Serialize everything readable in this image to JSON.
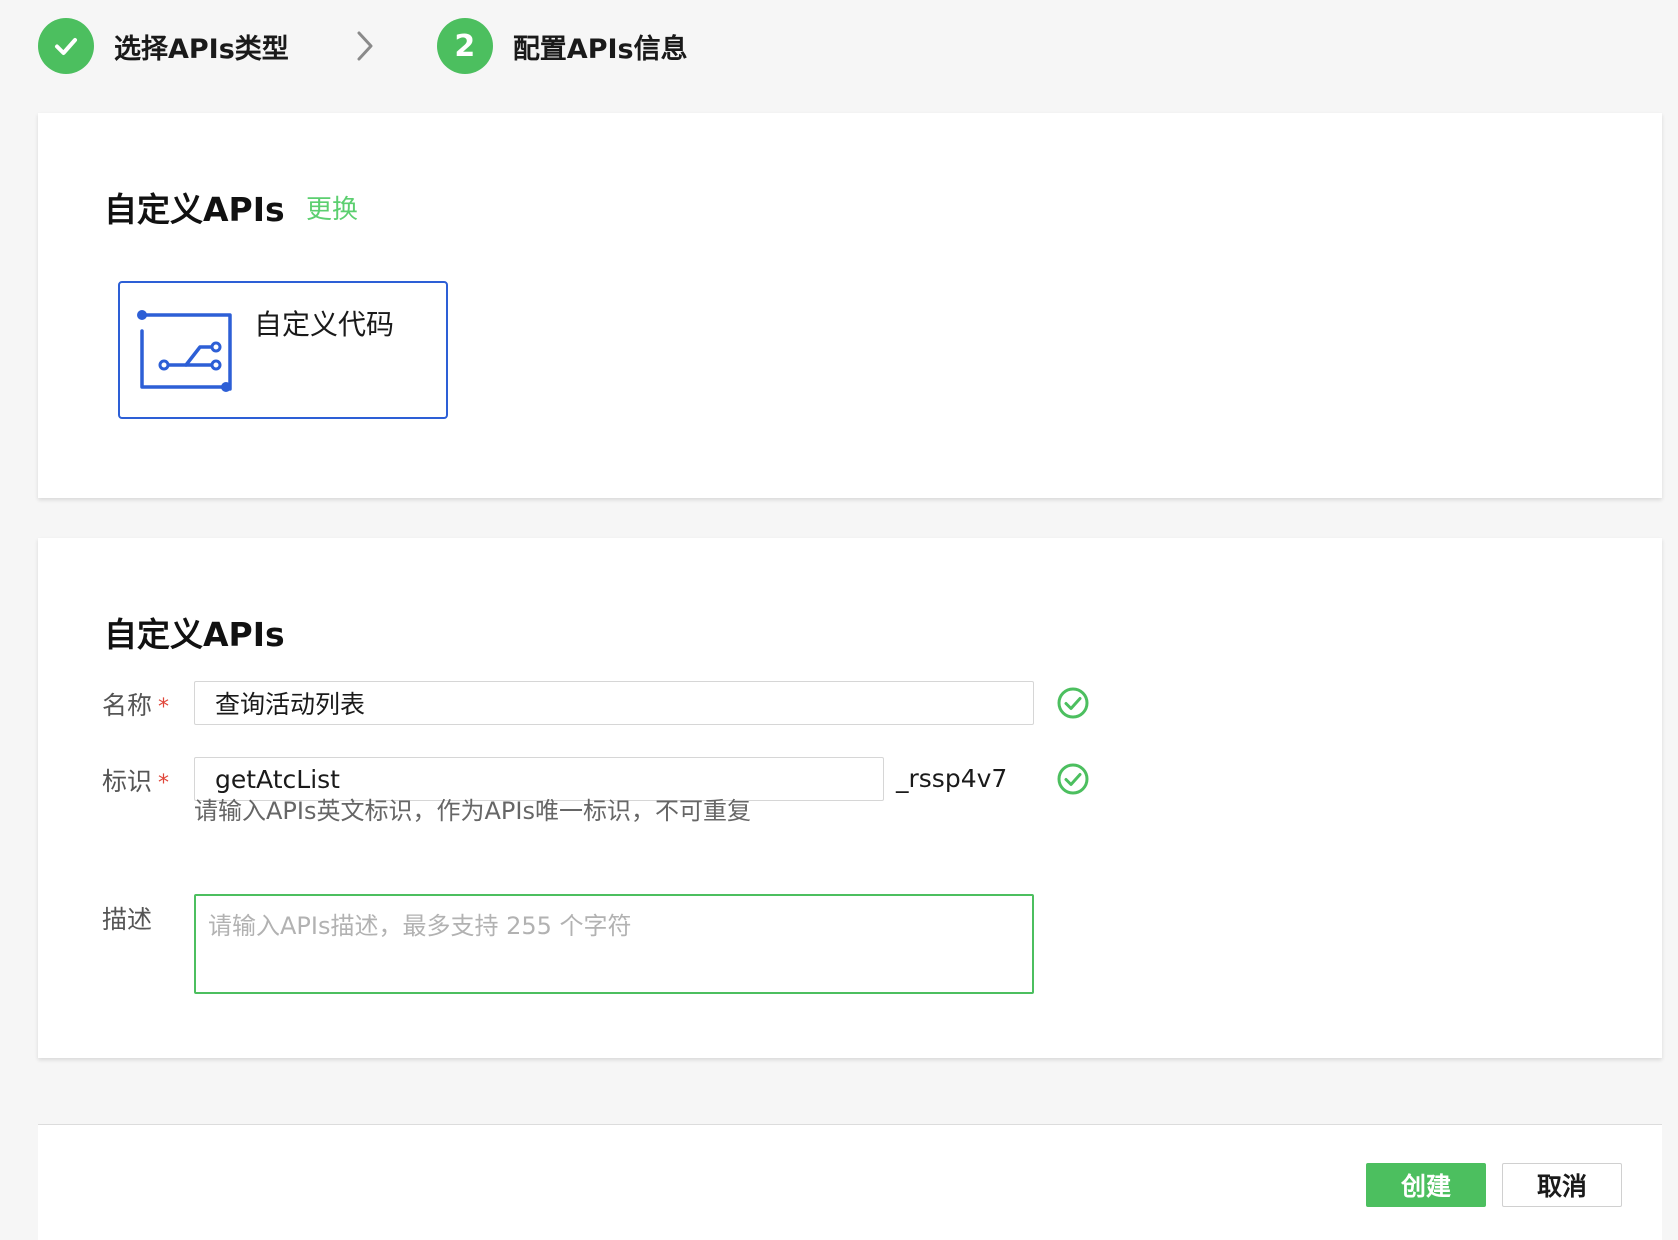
{
  "stepper": {
    "steps": [
      {
        "label": "选择APIs类型",
        "state": "done"
      },
      {
        "number": "2",
        "label": "配置APIs信息",
        "state": "active"
      }
    ]
  },
  "type_card": {
    "title": "自定义APIs",
    "change_link": "更换",
    "selected_type": {
      "label": "自定义代码",
      "icon": "custom-code-icon"
    }
  },
  "form_card": {
    "title": "自定义APIs",
    "fields": {
      "name": {
        "label": "名称",
        "required_mark": "*",
        "value": "查询活动列表",
        "valid": true
      },
      "identifier": {
        "label": "标识",
        "required_mark": "*",
        "value": "getAtcList",
        "suffix": "_rssp4v7",
        "valid": true,
        "hint": "请输入APIs英文标识，作为APIs唯一标识，不可重复"
      },
      "description": {
        "label": "描述",
        "value": "",
        "placeholder": "请输入APIs描述，最多支持 255 个字符"
      }
    }
  },
  "footer": {
    "create_label": "创建",
    "cancel_label": "取消"
  },
  "colors": {
    "accent_green": "#4cbf5f",
    "link_green": "#5ccf70",
    "tile_blue": "#2d5fd6",
    "required_red": "#e0463a"
  }
}
